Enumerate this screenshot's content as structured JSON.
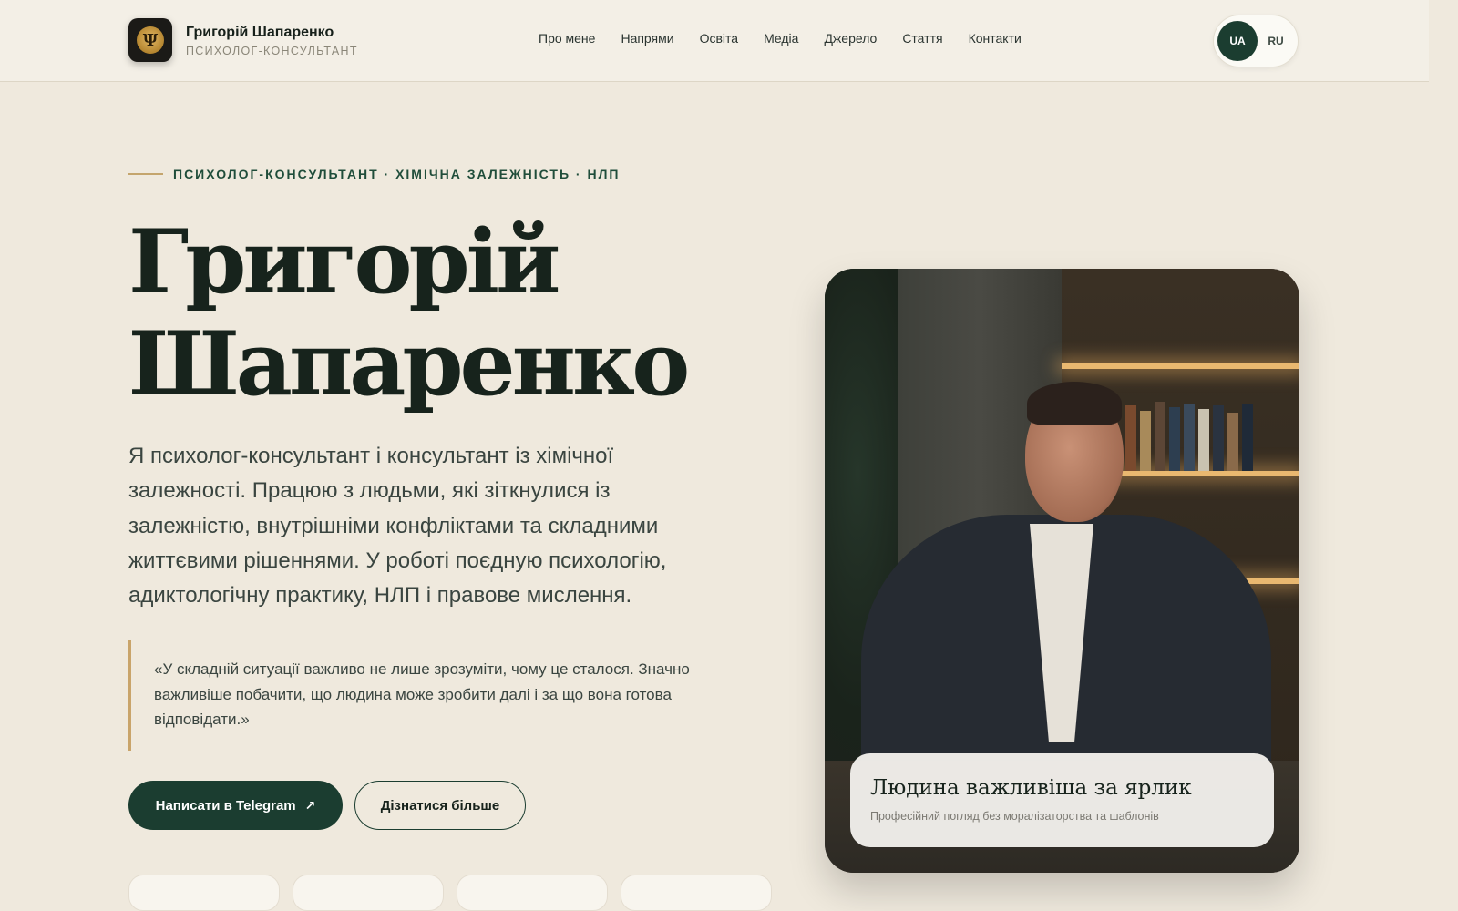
{
  "header": {
    "brand_name": "Григорій Шапаренко",
    "brand_sub": "ПСИХОЛОГ-КОНСУЛЬТАНТ",
    "logo_glyph": "Ψ",
    "nav": [
      "Про мене",
      "Напрями",
      "Освіта",
      "Медіа",
      "Джерело",
      "Стаття",
      "Контакти"
    ],
    "lang": {
      "active": "UA",
      "inactive": "RU"
    }
  },
  "hero": {
    "eyebrow": "ПСИХОЛОГ-КОНСУЛЬТАНТ · ХІМІЧНА ЗАЛЕЖНІСТЬ · НЛП",
    "title_line1": "Григорій",
    "title_line2": "Шапаренко",
    "description": "Я психолог-консультант і консультант із хімічної залежності. Працюю з людьми, які зіткнулися із залежністю, внутрішніми конфліктами та складними життєвими рішеннями. У роботі поєдную психологію, адиктологічну практику, НЛП і правове мислення.",
    "quote": "«У складній ситуації важливо не лише зрозуміти, чому це сталося. Значно важливіше побачити, що людина може зробити далі і за що вона готова відповідати.»",
    "btn_primary": "Написати в Telegram",
    "btn_primary_icon": "↗",
    "btn_secondary": "Дізнатися більше"
  },
  "photo_card": {
    "caption_title": "Людина важливіша за ярлик",
    "caption_sub": "Професійний погляд без моралізаторства та шаблонів"
  },
  "colors": {
    "accent": "#1b3d30",
    "gold": "#c9a46a",
    "background": "#efe9dd"
  }
}
